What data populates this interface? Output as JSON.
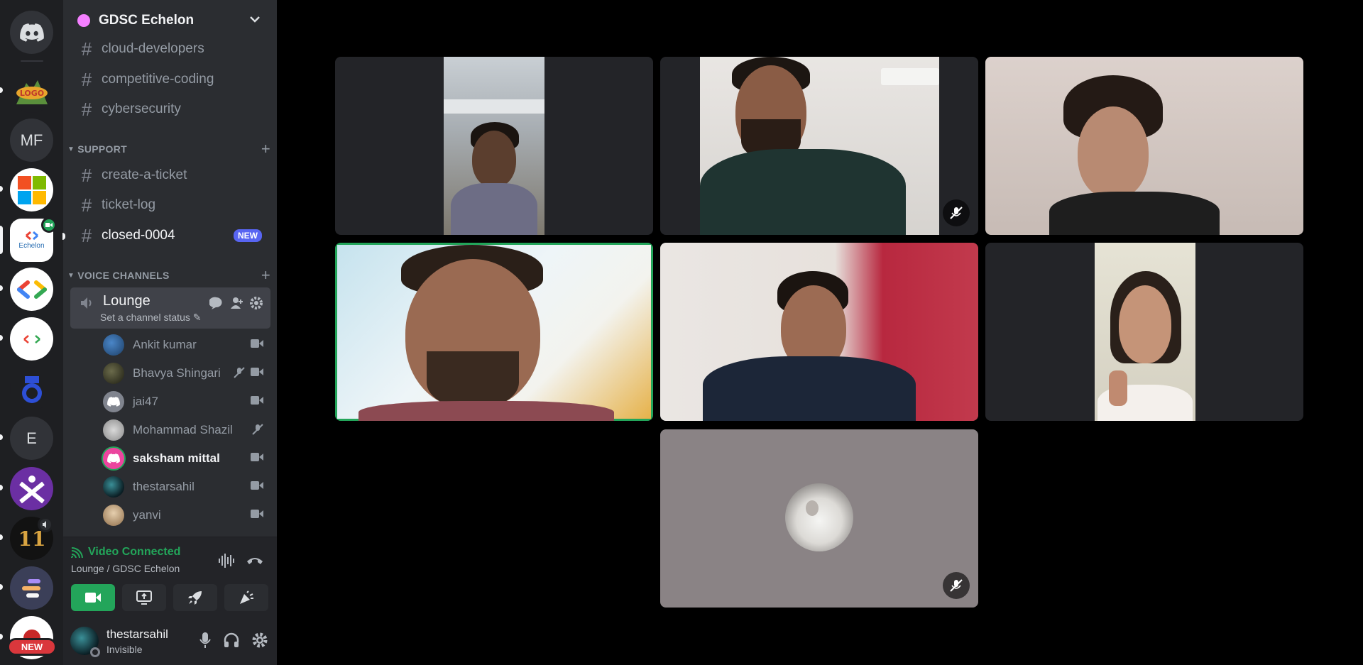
{
  "server": {
    "name": "GDSC Echelon",
    "rail": [
      {
        "label": "",
        "kind": "discord-home"
      },
      {
        "label": "",
        "kind": "server"
      },
      {
        "label": "MF",
        "kind": "server"
      },
      {
        "label": "",
        "kind": "microsoft"
      },
      {
        "label": "Echelon",
        "kind": "server"
      },
      {
        "label": "",
        "kind": "gdsc"
      },
      {
        "label": "",
        "kind": "server"
      },
      {
        "label": "",
        "kind": "server"
      },
      {
        "label": "E",
        "kind": "server"
      },
      {
        "label": "",
        "kind": "server"
      },
      {
        "label": "",
        "kind": "server"
      },
      {
        "label": "",
        "kind": "server"
      },
      {
        "label": "",
        "kind": "server"
      }
    ],
    "rail_new_badge": "NEW"
  },
  "channels": {
    "text_top": [
      "cloud-developers",
      "competitive-coding",
      "cybersecurity"
    ],
    "support_category": "SUPPORT",
    "support": [
      "create-a-ticket",
      "ticket-log",
      "closed-0004"
    ],
    "new_label": "NEW",
    "voice_category": "VOICE CHANNELS",
    "voice_channel_name": "Lounge",
    "voice_channel_status": "Set a channel status"
  },
  "members": [
    {
      "name": "Ankit kumar",
      "muted": false,
      "camera": true
    },
    {
      "name": "Bhavya Shingari",
      "muted": true,
      "camera": true
    },
    {
      "name": "jai47",
      "muted": false,
      "camera": true
    },
    {
      "name": "Mohammad Shazil",
      "muted": true,
      "camera": false
    },
    {
      "name": "saksham mittal",
      "muted": false,
      "camera": true
    },
    {
      "name": "thestarsahil",
      "muted": false,
      "camera": true
    },
    {
      "name": "yanvi",
      "muted": false,
      "camera": true
    }
  ],
  "voice_panel": {
    "status": "Video Connected",
    "location": "Lounge / GDSC Echelon"
  },
  "user": {
    "name": "thestarsahil",
    "status": "Invisible"
  },
  "colors": {
    "connected_green": "#23a55a",
    "brand_blurple": "#5865f2",
    "danger_red": "#da373c"
  }
}
